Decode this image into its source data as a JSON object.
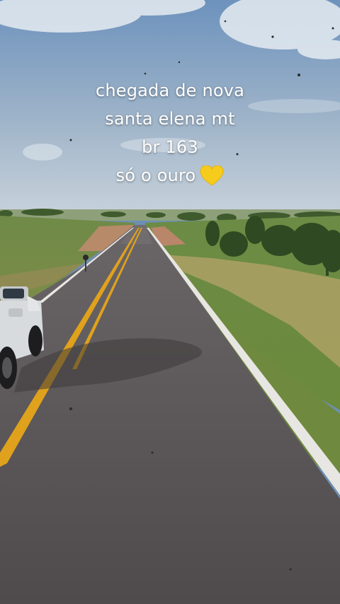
{
  "caption": {
    "line1": "chegada de nova",
    "line2": "santa elena mt",
    "line3": "br 163",
    "line4": "só o ouro"
  },
  "icons": {
    "heart": "yellow-heart-icon"
  },
  "colors": {
    "sky_top": "#6d92bd",
    "sky_bottom": "#c7d2dc",
    "road": "#5b5658",
    "center_line": "#e0a21c",
    "edge_line": "#e8e6e2",
    "grass": "#7a9a4c",
    "heart": "#f6cc1c"
  }
}
